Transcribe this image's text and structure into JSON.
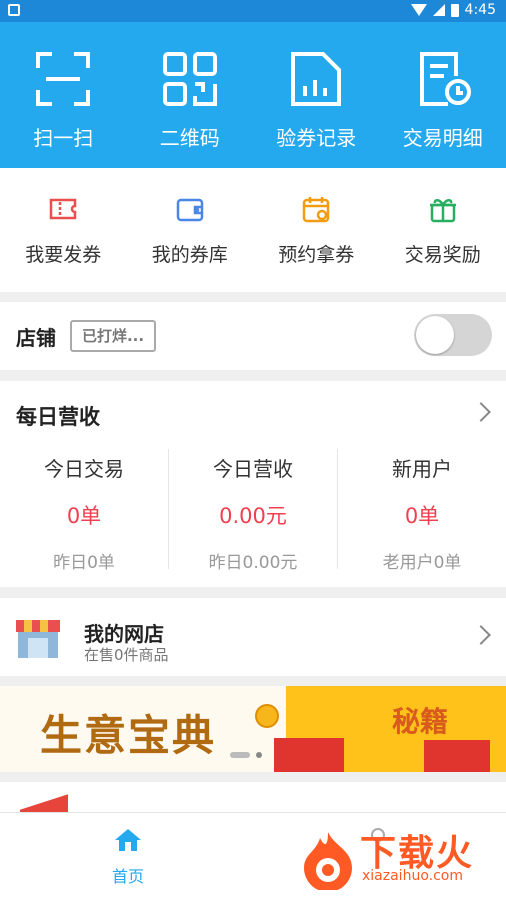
{
  "status_bar": {
    "time": "4:45"
  },
  "hero_actions": [
    {
      "label": "扫一扫",
      "icon": "scan-icon"
    },
    {
      "label": "二维码",
      "icon": "qrcode-icon"
    },
    {
      "label": "验券记录",
      "icon": "coupon-record-icon"
    },
    {
      "label": "交易明细",
      "icon": "transaction-detail-icon"
    }
  ],
  "quick_actions": [
    {
      "label": "我要发券",
      "icon": "coupon-icon",
      "color": "#e94f4f"
    },
    {
      "label": "我的券库",
      "icon": "wallet-icon",
      "color": "#4a86e8"
    },
    {
      "label": "预约拿券",
      "icon": "calendar-icon",
      "color": "#f39c12"
    },
    {
      "label": "交易奖励",
      "icon": "gift-icon",
      "color": "#27ae60"
    }
  ],
  "shop": {
    "title": "店铺",
    "status": "已打烊..."
  },
  "daily": {
    "title": "每日营收",
    "columns": [
      {
        "heading": "今日交易",
        "value": "0单",
        "sub": "昨日0单"
      },
      {
        "heading": "今日营收",
        "value": "0.00元",
        "sub": "昨日0.00元"
      },
      {
        "heading": "新用户",
        "value": "0单",
        "sub": "老用户0单"
      }
    ]
  },
  "store": {
    "name": "我的网店",
    "subtitle": "在售0件商品"
  },
  "banner": {
    "title": "生意宝典",
    "badge": "秘籍"
  },
  "tabs": [
    {
      "label": "首页"
    }
  ],
  "watermark": {
    "text": "下载火",
    "domain": "xiazaihuo.com"
  }
}
